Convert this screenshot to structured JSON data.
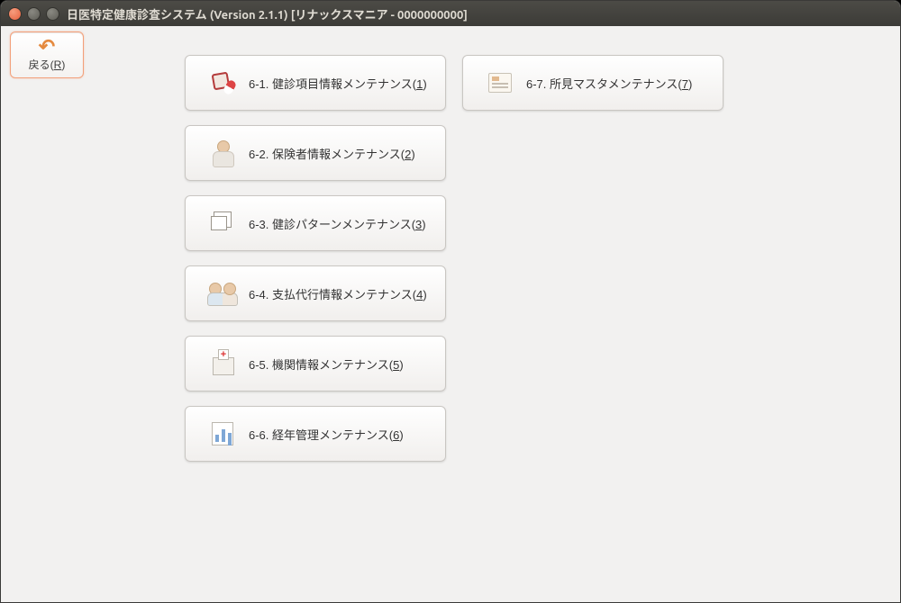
{
  "window": {
    "title": "日医特定健康診査システム (Version 2.1.1) [リナックスマニア - 0000000000]"
  },
  "back": {
    "label_pre": "戻る(",
    "label_key": "R",
    "label_post": ")"
  },
  "menu_left": [
    {
      "prefix": "6-1. 健診項目情報メンテナンス(",
      "key": "1",
      "suffix": ")",
      "icon": "meds-icon"
    },
    {
      "prefix": "6-2. 保険者情報メンテナンス(",
      "key": "2",
      "suffix": ")",
      "icon": "person-icon"
    },
    {
      "prefix": "6-3. 健診パターンメンテナンス(",
      "key": "3",
      "suffix": ")",
      "icon": "windows-icon"
    },
    {
      "prefix": "6-4. 支払代行情報メンテナンス(",
      "key": "4",
      "suffix": ")",
      "icon": "two-people-icon"
    },
    {
      "prefix": "6-5. 機関情報メンテナンス(",
      "key": "5",
      "suffix": ")",
      "icon": "hospital-icon"
    },
    {
      "prefix": "6-6. 経年管理メンテナンス(",
      "key": "6",
      "suffix": ")",
      "icon": "chart-icon"
    }
  ],
  "menu_right": [
    {
      "prefix": "6-7. 所見マスタメンテナンス(",
      "key": "7",
      "suffix": ")",
      "icon": "form-icon"
    }
  ]
}
